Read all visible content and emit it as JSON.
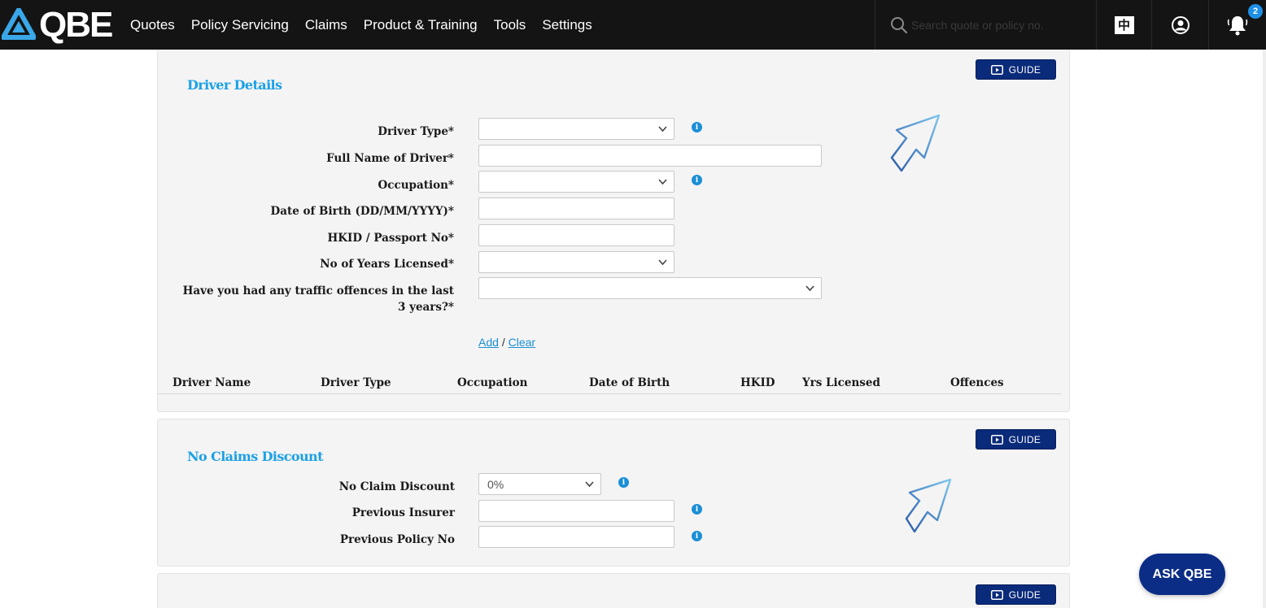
{
  "nav": {
    "brand": "QBE",
    "menu": [
      "Quotes",
      "Policy Servicing",
      "Claims",
      "Product & Training",
      "Tools",
      "Settings"
    ],
    "search_placeholder": "Search quote or policy no.",
    "lang_label": "中",
    "notification_count": "2"
  },
  "guide_label": "GUIDE",
  "driver": {
    "title": "Driver Details",
    "fields": {
      "driver_type": "Driver Type*",
      "full_name": "Full Name of Driver*",
      "occupation": "Occupation*",
      "dob": "Date of Birth (DD/MM/YYYY)*",
      "hkid": "HKID / Passport No*",
      "years_licensed": "No of Years Licensed*",
      "offences_line1": "Have you had any traffic offences in the last",
      "offences_line2": "3 years?*"
    },
    "add_label": "Add",
    "separator": "/",
    "clear_label": "Clear",
    "table_headers": [
      "Driver Name",
      "Driver Type",
      "Occupation",
      "Date of Birth",
      "HKID",
      "Yrs Licensed",
      "Offences"
    ]
  },
  "ncd": {
    "title": "No Claims Discount",
    "ncd_label": "No Claim Discount",
    "ncd_value": "0%",
    "prev_insurer_label": "Previous Insurer",
    "prev_policy_label": "Previous Policy No"
  },
  "ask_label": "ASK QBE",
  "colors": {
    "nav_bg": "#141414",
    "accent_blue": "#1ba0e6",
    "guide_navy": "#0a2a7a"
  }
}
